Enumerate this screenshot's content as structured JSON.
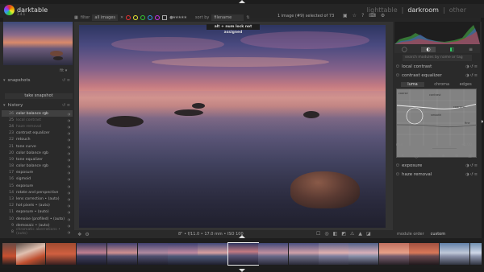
{
  "app": {
    "name": "darktable",
    "version": "3.4.1",
    "views": [
      "lighttable",
      "darkroom",
      "other"
    ],
    "active_view": "darkroom"
  },
  "filterbar": {
    "filter_label": "filter",
    "filter_value": "all images",
    "sort_label": "sort by",
    "sort_value": "filename",
    "selection_info": "1 image (#9) selected of 73"
  },
  "toast": "alt + num lock not assigned",
  "left": {
    "fit_label": "fit",
    "snapshots_label": "snapshots",
    "take_snapshot_label": "take snapshot",
    "history_label": "history",
    "history": [
      {
        "n": "26",
        "label": "color balance rgb",
        "state": "selected"
      },
      {
        "n": "25",
        "label": "local contrast",
        "state": "dim"
      },
      {
        "n": "24",
        "label": "haze removal",
        "state": "dim"
      },
      {
        "n": "23",
        "label": "contrast equalizer",
        "state": "normal"
      },
      {
        "n": "22",
        "label": "retouch",
        "state": "normal"
      },
      {
        "n": "21",
        "label": "tone curve",
        "state": "normal"
      },
      {
        "n": "20",
        "label": "color balance rgb",
        "state": "normal"
      },
      {
        "n": "19",
        "label": "tone equalizer",
        "state": "normal"
      },
      {
        "n": "18",
        "label": "color balance rgb",
        "state": "normal"
      },
      {
        "n": "17",
        "label": "exposure",
        "state": "normal"
      },
      {
        "n": "16",
        "label": "sigmoid",
        "state": "normal"
      },
      {
        "n": "15",
        "label": "exposure",
        "state": "normal"
      },
      {
        "n": "14",
        "label": "rotate and perspective",
        "state": "normal"
      },
      {
        "n": "13",
        "label": "lens correction • (auto)",
        "state": "normal"
      },
      {
        "n": "12",
        "label": "hot pixels • (auto)",
        "state": "normal"
      },
      {
        "n": "11",
        "label": "exposure • (auto)",
        "state": "normal"
      },
      {
        "n": "10",
        "label": "denoise (profiled) • (auto)",
        "state": "normal"
      },
      {
        "n": "9",
        "label": "demosaic • (auto)",
        "state": "normal"
      },
      {
        "n": "8",
        "label": "chromatic aberrations • (auto)",
        "state": "dim"
      }
    ]
  },
  "right": {
    "search_placeholder": "search modules by name or tag",
    "modules": [
      "local contrast",
      "contrast equalizer"
    ],
    "eq_tabs": [
      "luma",
      "chroma",
      "edges"
    ],
    "eq_active_tab": "luma",
    "eq_labels": {
      "top_left": "coarse",
      "top_center": "contrast",
      "bottom_center": "smooth",
      "right_mid": "coarsest",
      "right_low": "fine"
    },
    "eq_bottom_left": "mix",
    "eq_bottom_right": "+1.00",
    "lower_modules": [
      "exposure",
      "haze removal"
    ]
  },
  "bottom": {
    "image_info": "8\" • f/11.0 • 17.0 mm • ISO 100",
    "module_order_label": "module order",
    "module_order_value": "custom"
  },
  "colors": {
    "accent": "#e59d8a",
    "panel": "#2a2a2a",
    "background": "#262626"
  }
}
